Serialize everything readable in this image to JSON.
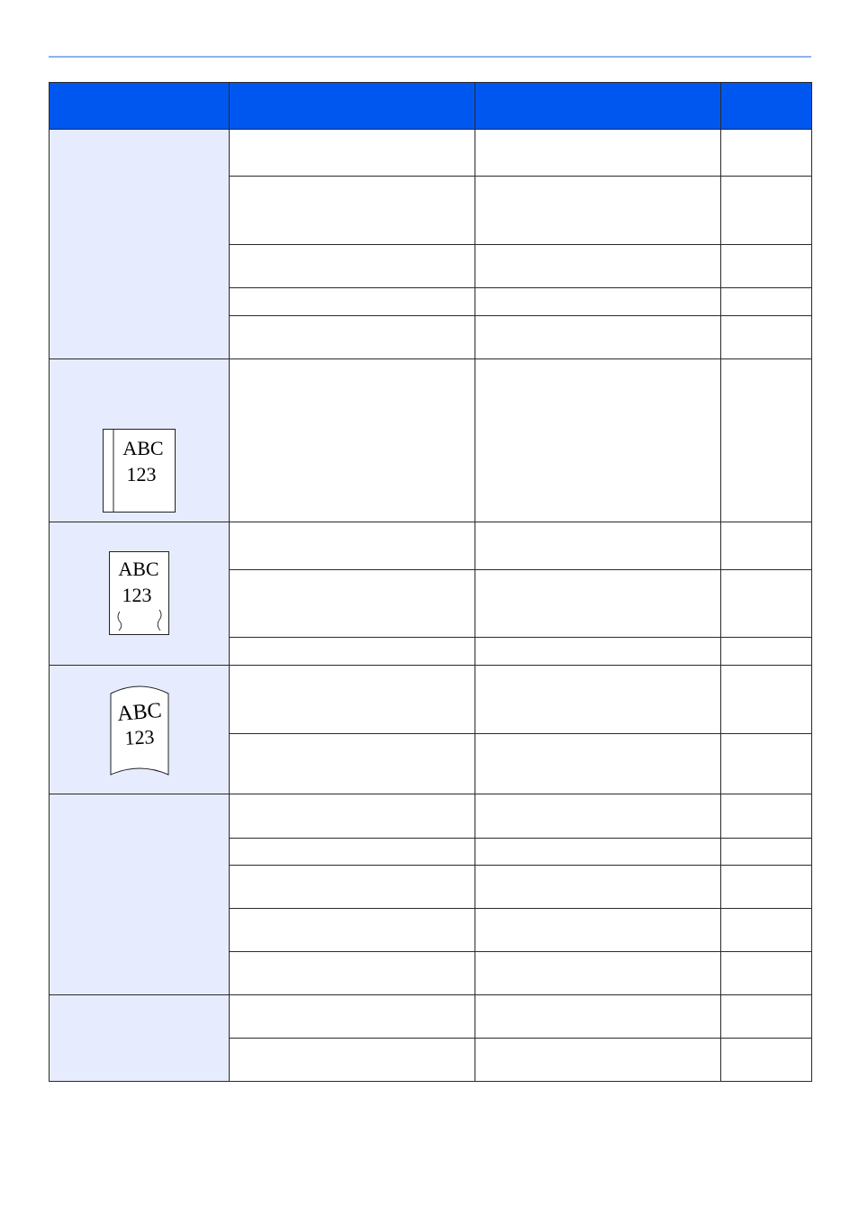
{
  "header": {
    "columns": [
      "",
      "",
      "",
      ""
    ]
  },
  "groups": [
    {
      "symptom": "",
      "illustration": null,
      "rows": 5
    },
    {
      "symptom": "",
      "illustration": {
        "name": "binding-shadow-illustration",
        "line1": "ABC",
        "line2": "123"
      },
      "rows": 1
    },
    {
      "symptom": "",
      "illustration": {
        "name": "wrinkled-page-illustration",
        "line1": "ABC",
        "line2": "123"
      },
      "rows": 3
    },
    {
      "symptom": "",
      "illustration": {
        "name": "curled-page-illustration",
        "line1": "ABC",
        "line2": "123"
      },
      "rows": 2
    },
    {
      "symptom": "",
      "illustration": null,
      "rows": 5
    },
    {
      "symptom": "",
      "illustration": null,
      "rows": 2
    }
  ]
}
